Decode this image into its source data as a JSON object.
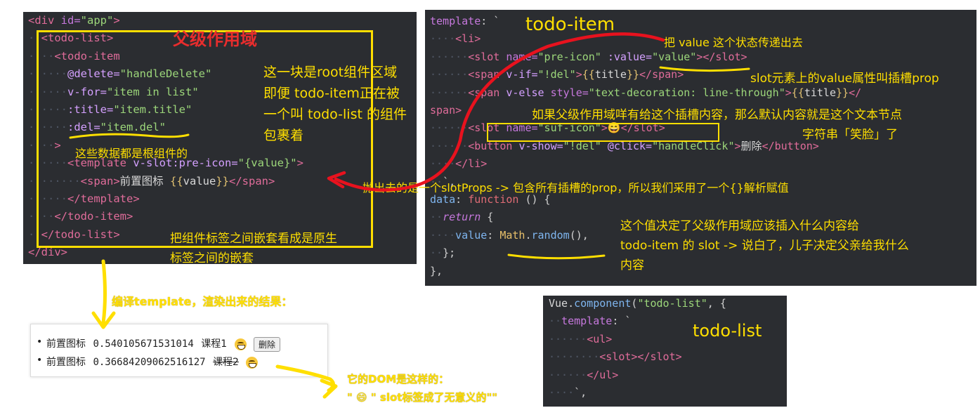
{
  "left_code": {
    "lines": [
      [
        {
          "c": "tag",
          "t": "<div "
        },
        {
          "c": "attr",
          "t": "id="
        },
        {
          "c": "str",
          "t": "\"app\""
        },
        {
          "c": "tag",
          "t": ">"
        }
      ],
      [
        {
          "c": "ind",
          "t": "··"
        },
        {
          "c": "tag",
          "t": "<todo-list>"
        }
      ],
      [
        {
          "c": "ind",
          "t": "····"
        },
        {
          "c": "tag",
          "t": "<todo-item"
        }
      ],
      [
        {
          "c": "ind",
          "t": "······"
        },
        {
          "c": "dattr",
          "t": "@delete="
        },
        {
          "c": "str",
          "t": "\"handleDelete\""
        }
      ],
      [
        {
          "c": "ind",
          "t": "······"
        },
        {
          "c": "dattr",
          "t": "v-for="
        },
        {
          "c": "str",
          "t": "\"item in list\""
        }
      ],
      [
        {
          "c": "ind",
          "t": "······"
        },
        {
          "c": "dattr",
          "t": ":title="
        },
        {
          "c": "str",
          "t": "\"item.title\""
        }
      ],
      [
        {
          "c": "ind",
          "t": "······"
        },
        {
          "c": "dattr",
          "t": ":del="
        },
        {
          "c": "str",
          "t": "\"item.del\""
        }
      ],
      [
        {
          "c": "ind",
          "t": "····"
        },
        {
          "c": "tag",
          "t": ">"
        }
      ],
      [
        {
          "c": "ind",
          "t": "······"
        },
        {
          "c": "tag",
          "t": "<template "
        },
        {
          "c": "dattr",
          "t": "v-slot:pre-icon="
        },
        {
          "c": "str",
          "t": "\"{value}\""
        },
        {
          "c": "tag",
          "t": ">"
        }
      ],
      [
        {
          "c": "ind",
          "t": "········"
        },
        {
          "c": "tag",
          "t": "<span>"
        },
        {
          "c": "txt",
          "t": "前置图标 "
        },
        {
          "c": "brk",
          "t": "{{"
        },
        {
          "c": "txt",
          "t": "value"
        },
        {
          "c": "brk",
          "t": "}}"
        },
        {
          "c": "tag",
          "t": "</span>"
        }
      ],
      [
        {
          "c": "ind",
          "t": "······"
        },
        {
          "c": "tag",
          "t": "</template>"
        }
      ],
      [
        {
          "c": "ind",
          "t": "····"
        },
        {
          "c": "tag",
          "t": "</todo-item>"
        }
      ],
      [
        {
          "c": "ind",
          "t": "··"
        },
        {
          "c": "tag",
          "t": "</todo-list>"
        }
      ],
      [
        {
          "c": "tag",
          "t": "</div>"
        }
      ]
    ]
  },
  "right_code": {
    "lines": [
      [
        {
          "c": "attr",
          "t": "template"
        },
        {
          "c": "pct",
          "t": ": `"
        }
      ],
      [
        {
          "c": "ind",
          "t": "····"
        },
        {
          "c": "tag",
          "t": "<li>"
        }
      ],
      [
        {
          "c": "ind",
          "t": "······"
        },
        {
          "c": "tag",
          "t": "<slot "
        },
        {
          "c": "attr",
          "t": "name="
        },
        {
          "c": "str",
          "t": "\"pre-icon\""
        },
        {
          "c": "txt",
          "t": " "
        },
        {
          "c": "dattr",
          "t": ":value="
        },
        {
          "c": "str",
          "t": "\"value\""
        },
        {
          "c": "tag",
          "t": "></slot>"
        }
      ],
      [
        {
          "c": "ind",
          "t": "······"
        },
        {
          "c": "tag",
          "t": "<span "
        },
        {
          "c": "dattr",
          "t": "v-if="
        },
        {
          "c": "str",
          "t": "\"!del\""
        },
        {
          "c": "tag",
          "t": ">"
        },
        {
          "c": "brk",
          "t": "{{"
        },
        {
          "c": "txt",
          "t": "title"
        },
        {
          "c": "brk",
          "t": "}}"
        },
        {
          "c": "tag",
          "t": "</span>"
        }
      ],
      [
        {
          "c": "ind",
          "t": "······"
        },
        {
          "c": "tag",
          "t": "<span "
        },
        {
          "c": "dattr",
          "t": "v-else "
        },
        {
          "c": "attr",
          "t": "style="
        },
        {
          "c": "str",
          "t": "\"text-decoration: line-through\""
        },
        {
          "c": "tag",
          "t": ">"
        },
        {
          "c": "brk",
          "t": "{{"
        },
        {
          "c": "txt",
          "t": "title"
        },
        {
          "c": "brk",
          "t": "}}"
        },
        {
          "c": "tag",
          "t": "</"
        }
      ],
      [
        {
          "c": "tag",
          "t": "span>"
        }
      ],
      [
        {
          "c": "ind",
          "t": "······"
        },
        {
          "c": "tag",
          "t": "<slot "
        },
        {
          "c": "attr",
          "t": "name="
        },
        {
          "c": "str",
          "t": "\"suf-icon\""
        },
        {
          "c": "tag",
          "t": ">"
        },
        {
          "c": "txt",
          "t": "😄"
        },
        {
          "c": "tag",
          "t": "</slot>"
        }
      ],
      [
        {
          "c": "ind",
          "t": "······"
        },
        {
          "c": "tag",
          "t": "<button "
        },
        {
          "c": "dattr",
          "t": "v-show="
        },
        {
          "c": "str",
          "t": "\"!del\""
        },
        {
          "c": "txt",
          "t": " "
        },
        {
          "c": "dattr",
          "t": "@click="
        },
        {
          "c": "str",
          "t": "\"handleClick\""
        },
        {
          "c": "tag",
          "t": ">"
        },
        {
          "c": "txt",
          "t": "删除"
        },
        {
          "c": "tag",
          "t": "</button>"
        }
      ],
      [
        {
          "c": "ind",
          "t": "····"
        },
        {
          "c": "tag",
          "t": "</li>"
        }
      ],
      [
        {
          "c": "ind",
          "t": "··"
        },
        {
          "c": "pct",
          "t": "`,"
        }
      ],
      [
        {
          "c": "fn",
          "t": "data"
        },
        {
          "c": "pct",
          "t": ": "
        },
        {
          "c": "kw",
          "t": "function"
        },
        {
          "c": "pct",
          "t": " () {"
        }
      ],
      [
        {
          "c": "ind",
          "t": "··"
        },
        {
          "c": "ital",
          "t": "return"
        },
        {
          "c": "pct",
          "t": " {"
        }
      ],
      [
        {
          "c": "ind",
          "t": "····"
        },
        {
          "c": "fn",
          "t": "value"
        },
        {
          "c": "pct",
          "t": ": "
        },
        {
          "c": "mth",
          "t": "Math"
        },
        {
          "c": "pct",
          "t": "."
        },
        {
          "c": "fn",
          "t": "random"
        },
        {
          "c": "pct",
          "t": "(),"
        }
      ],
      [
        {
          "c": "ind",
          "t": "··"
        },
        {
          "c": "pct",
          "t": "};"
        }
      ],
      [
        {
          "c": "pct",
          "t": "},"
        }
      ]
    ]
  },
  "bottom_code": {
    "lines": [
      [
        {
          "c": "txt",
          "t": "Vue"
        },
        {
          "c": "pct",
          "t": "."
        },
        {
          "c": "fn",
          "t": "component"
        },
        {
          "c": "pct",
          "t": "("
        },
        {
          "c": "str",
          "t": "\"todo-list\""
        },
        {
          "c": "pct",
          "t": ", {"
        }
      ],
      [
        {
          "c": "ind",
          "t": "··"
        },
        {
          "c": "attr",
          "t": "template"
        },
        {
          "c": "pct",
          "t": ": `"
        }
      ],
      [
        {
          "c": "ind",
          "t": "······"
        },
        {
          "c": "tag",
          "t": "<ul>"
        }
      ],
      [
        {
          "c": "ind",
          "t": "········"
        },
        {
          "c": "tag",
          "t": "<slot></slot>"
        }
      ],
      [
        {
          "c": "ind",
          "t": "······"
        },
        {
          "c": "tag",
          "t": "</ul>"
        }
      ],
      [
        {
          "c": "ind",
          "t": "····"
        },
        {
          "c": "pct",
          "t": "`,"
        }
      ]
    ]
  },
  "annotations": {
    "parent_scope": "父级作用域",
    "root_area": [
      "这一块是root组件区域",
      "即便 todo-item正在被",
      "一个叫 todo-list 的组件",
      "包裹着"
    ],
    "data_from_root": "这些数据都是根组件的",
    "nested_note": [
      "把组件标签之间嵌套看成是原生",
      "标签之间的嵌套"
    ],
    "todo_item_title": "todo-item",
    "pass_value": "把 value 这个状态传递出去",
    "slot_prop": "slot元素上的value属性叫插槽prop",
    "default_content": "如果父级作用域咩有给这个插槽内容，那么默认内容就是这个文本节点",
    "smile_string": "字符串「笑脸」了",
    "slot_props": "抛出去的是一个slotProps -> 包含所有插槽的prop，所以我们采用了一个{}解析赋值",
    "value_decides": [
      "这个值决定了父级作用域应该插入什么内容给",
      "todo-item 的 slot  -> 说白了，儿子决定父亲给我什么",
      "内容"
    ],
    "compile_result": "编译template，渲染出来的结果：",
    "todo_list_title": "todo-list",
    "dom_like": "它的DOM是这样的：",
    "dom_note": "\" 😄 \" slot标签成了无意义的\"\""
  },
  "render": {
    "items": [
      {
        "prefix": "前置图标",
        "value": "0.540105671531014",
        "title": "课程1",
        "delete_label": "删除"
      },
      {
        "prefix": "前置图标",
        "value": "0.36684209062516127",
        "title": "课程2"
      }
    ]
  },
  "colors": {
    "accent": "#ffdf00",
    "arrow": "#e8121e",
    "panel": "#2b2d31"
  }
}
